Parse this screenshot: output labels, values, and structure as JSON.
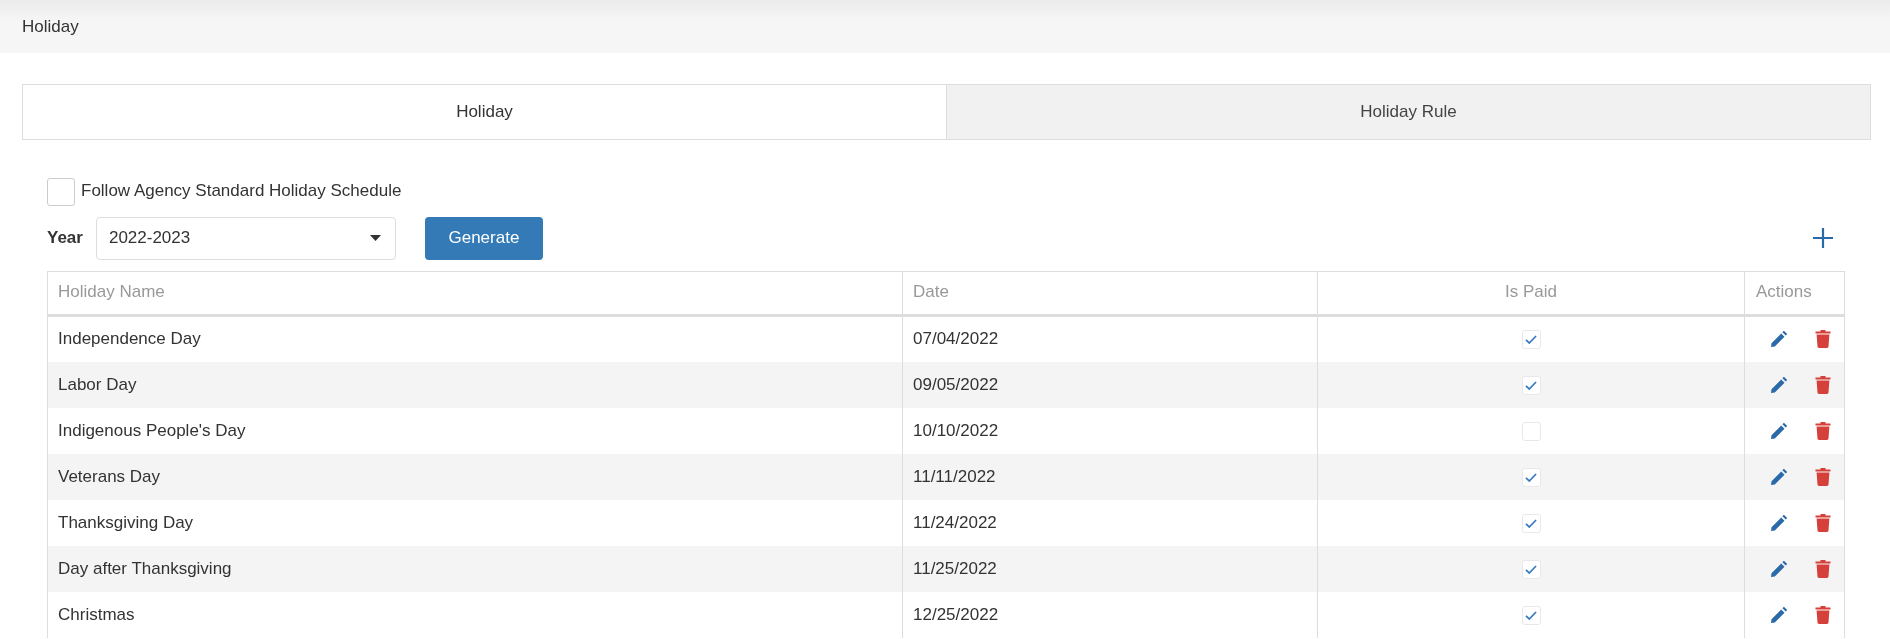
{
  "header": {
    "title": "Holiday"
  },
  "tabs": [
    {
      "label": "Holiday",
      "selected": true
    },
    {
      "label": "Holiday Rule",
      "selected": false
    }
  ],
  "follow_standard": {
    "label": "Follow Agency Standard Holiday Schedule",
    "checked": false
  },
  "year": {
    "label": "Year",
    "value": "2022-2023"
  },
  "generate_button": "Generate",
  "table": {
    "columns": [
      "Holiday Name",
      "Date",
      "Is Paid",
      "Actions"
    ],
    "rows": [
      {
        "name": "Independence Day",
        "date": "07/04/2022",
        "paid": true
      },
      {
        "name": "Labor Day",
        "date": "09/05/2022",
        "paid": true
      },
      {
        "name": "Indigenous People's Day",
        "date": "10/10/2022",
        "paid": false
      },
      {
        "name": "Veterans Day",
        "date": "11/11/2022",
        "paid": true
      },
      {
        "name": "Thanksgiving Day",
        "date": "11/24/2022",
        "paid": true
      },
      {
        "name": "Day after Thanksgiving",
        "date": "11/25/2022",
        "paid": true
      },
      {
        "name": "Christmas",
        "date": "12/25/2022",
        "paid": true
      }
    ]
  }
}
